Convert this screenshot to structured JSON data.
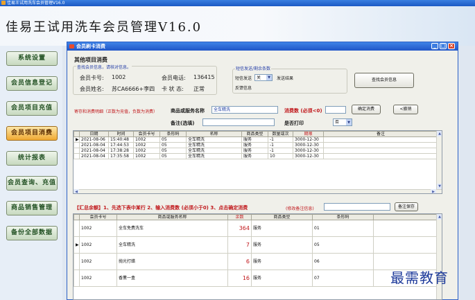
{
  "window": {
    "title": "佳易王试用洗车会员管理V16.0"
  },
  "header": {
    "title": "佳易王试用洗车会员管理V16.0"
  },
  "sidebar": {
    "items": [
      {
        "label": "系统设置"
      },
      {
        "label": "会员信息登记"
      },
      {
        "label": "会员项目充值"
      },
      {
        "label": "会员项目消费",
        "active": true
      },
      {
        "label": "统计报表"
      },
      {
        "label": "会员查询、充值"
      },
      {
        "label": "商品销售管理"
      },
      {
        "label": "备份全部数据"
      }
    ]
  },
  "dialog": {
    "title": "会员刷卡消费",
    "section_title": "其他项目消费",
    "member_hint": "查找会员信息，请核对信息。",
    "card_no_label": "会员卡号:",
    "card_no": "1002",
    "phone_label": "会员电话:",
    "phone": "136415",
    "name_label": "会员姓名:",
    "name": "苏CA6666+李四",
    "status_label": "卡 状 态:",
    "status": "正常",
    "sms": {
      "title": "短信发送/剩余条数",
      "send_label": "短信发送",
      "send_value": "关",
      "result_label": "发送结果",
      "feedback_label": "反馈信息"
    },
    "find_button": "查找会员信息",
    "detail_note": "寄存和消费明细（正数为充值，负数为消费）",
    "product_label": "商品或服务名称",
    "product_value": "全车精洗",
    "amount_label": "消费数 (必须<0)",
    "amount_value": "",
    "confirm_button": "确定消费",
    "cancel_button": "撤销",
    "remark_label": "备注(选填)",
    "remark_value": "",
    "print_label": "是否打印",
    "print_value": "否"
  },
  "records": {
    "columns": [
      "日期",
      "时间",
      "会员卡号",
      "条形码",
      "名称",
      "商品类型",
      "数量或次",
      "期限",
      "备注"
    ],
    "rows": [
      [
        "2021-08-06",
        "15:40:48",
        "1002",
        "05",
        "全车精洗",
        "服务",
        "-1",
        "3000-12-30",
        ""
      ],
      [
        "2021-08-04",
        "17:44:53",
        "1002",
        "05",
        "全车精洗",
        "服务",
        "-1",
        "3000-12-30",
        ""
      ],
      [
        "2021-08-04",
        "17:38:28",
        "1002",
        "05",
        "全车精洗",
        "服务",
        "-1",
        "3000-12-30",
        ""
      ],
      [
        "2021-08-04",
        "17:35:58",
        "1002",
        "05",
        "全车精洗",
        "服务",
        "10",
        "3000-12-30",
        ""
      ]
    ]
  },
  "summary": {
    "instruction": "【汇总余额】1、先选下表中某行 2、输入消费数 (必须小于0) 3、点击确定消费",
    "note": "(修改备注信息)",
    "note_value": "",
    "save_button": "备注保存",
    "columns": [
      "会员卡号",
      "商品或服务名称",
      "余数",
      "商品类型",
      "条形码"
    ],
    "rows": [
      [
        "1002",
        "全车免费洗车",
        "364",
        "服务",
        "01"
      ],
      [
        "1002",
        "全车精洗",
        "7",
        "服务",
        "05"
      ],
      [
        "1002",
        "抛光打蜡",
        "6",
        "服务",
        "06"
      ],
      [
        "1002",
        "香薰一盒",
        "16",
        "服务",
        "07"
      ]
    ]
  },
  "watermark": "最需教育"
}
